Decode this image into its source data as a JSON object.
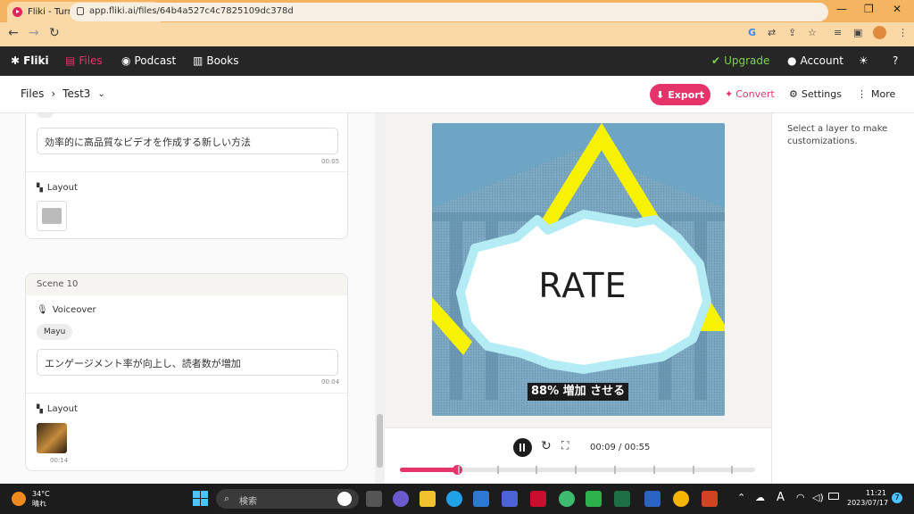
{
  "browser": {
    "tab_title": "Fliki - Turn text into videos w",
    "url": "app.fliki.ai/files/64b4a527c4c7825109dc378d"
  },
  "app_nav": {
    "brand": "Fliki",
    "files": "Files",
    "podcast": "Podcast",
    "books": "Books",
    "upgrade": "Upgrade",
    "account": "Account"
  },
  "toolbar": {
    "breadcrumb_root": "Files",
    "file_name": "Test3",
    "export_label": "Export",
    "convert_label": "Convert",
    "settings_label": "Settings",
    "more_label": "More"
  },
  "scenes": {
    "prev_scene": {
      "text": "効率的に高品質なビデオを作成する新しい方法",
      "text_time": "00:05",
      "layout_label": "Layout"
    },
    "scene10": {
      "title": "Scene 10",
      "voiceover_label": "Voiceover",
      "voice": "Mayu",
      "text": "エンゲージメント率が向上し、読者数が増加",
      "text_time": "00:04",
      "layout_label": "Layout",
      "thumb_time": "00:14"
    }
  },
  "preview": {
    "headline": "RATE",
    "subtitle": "88% 増加 させる"
  },
  "player": {
    "time": "00:09 / 00:55",
    "progress": 0.16
  },
  "right_panel": {
    "hint": "Select a layer to make customizations."
  },
  "taskbar": {
    "weather_temp": "34°C",
    "weather_desc": "晴れ",
    "search_placeholder": "検索",
    "clock_time": "11:21",
    "clock_date": "2023/07/17",
    "ime": "A"
  },
  "colors": {
    "accent": "#e5346a",
    "upgrade": "#7fd34a",
    "tab_bar": "#f5b45f",
    "header": "#262626"
  }
}
